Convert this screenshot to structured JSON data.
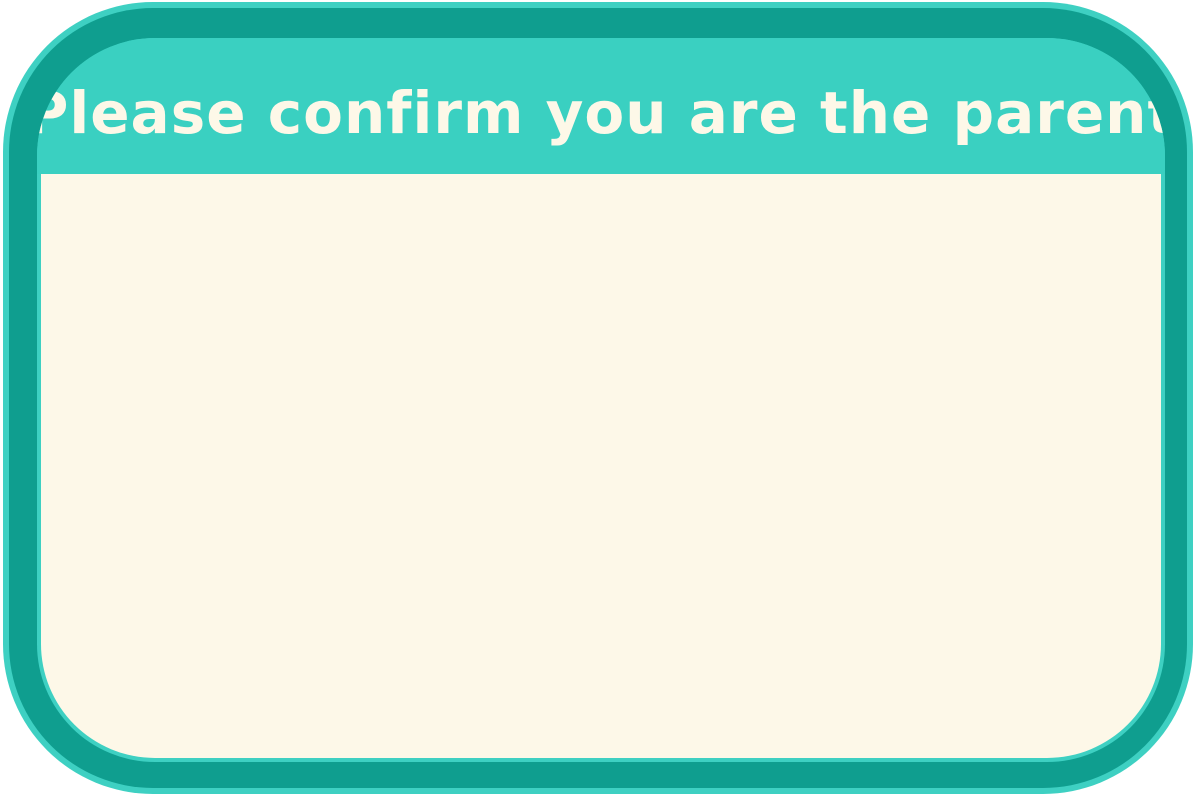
{
  "dialog": {
    "title": "Please confirm you are the parent"
  },
  "colors": {
    "frame_outer": "#3ed0c2",
    "frame_dark": "#0f9e8f",
    "header": "#3ad0c1",
    "body": "#fdf8e8",
    "title_text": "#fdf8e8"
  }
}
